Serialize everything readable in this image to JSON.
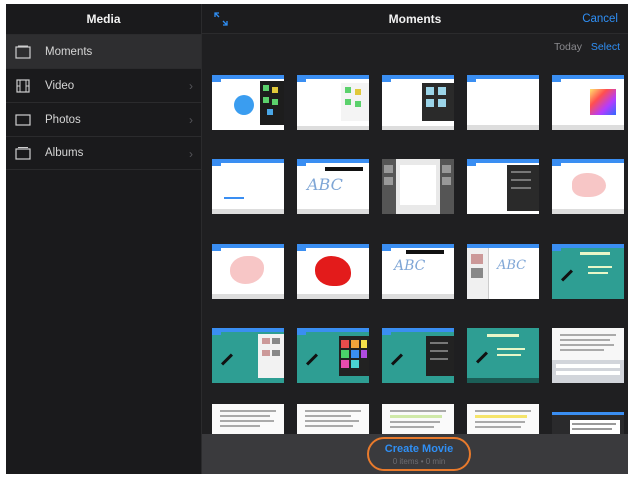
{
  "sidebar": {
    "title": "Media",
    "items": [
      {
        "label": "Moments",
        "icon": "moments-icon"
      },
      {
        "label": "Video",
        "icon": "film-icon"
      },
      {
        "label": "Photos",
        "icon": "photo-icon"
      },
      {
        "label": "Albums",
        "icon": "albums-icon"
      }
    ]
  },
  "header": {
    "title": "Moments",
    "cancel_label": "Cancel",
    "expand_icon": "expand-icon"
  },
  "subheader": {
    "date_label": "Today",
    "select_label": "Select"
  },
  "thumbnails": [
    {
      "kind": "whiteboard-with-blue-circle-and-tools"
    },
    {
      "kind": "whiteboard-green-tools"
    },
    {
      "kind": "whiteboard-grid-panel"
    },
    {
      "kind": "whiteboard-blank"
    },
    {
      "kind": "whiteboard-color-picker"
    },
    {
      "kind": "whiteboard-small-writing"
    },
    {
      "kind": "whiteboard-abc-text"
    },
    {
      "kind": "photo-grid-app"
    },
    {
      "kind": "dark-menu-panel"
    },
    {
      "kind": "whiteboard-pink-shape"
    },
    {
      "kind": "whiteboard-pink-blob"
    },
    {
      "kind": "whiteboard-red-blob"
    },
    {
      "kind": "whiteboard-abc-text-2"
    },
    {
      "kind": "split-panel-abc"
    },
    {
      "kind": "teal-title-slide"
    },
    {
      "kind": "teal-slide-with-panel"
    },
    {
      "kind": "teal-slide-color-grid"
    },
    {
      "kind": "teal-slide-dark-menu"
    },
    {
      "kind": "teal-title-slide-2"
    },
    {
      "kind": "document-with-keyboard"
    },
    {
      "kind": "document-page"
    },
    {
      "kind": "document-page-2"
    },
    {
      "kind": "document-page-highlight"
    },
    {
      "kind": "document-page-yellow"
    },
    {
      "kind": "document-app-dark"
    }
  ],
  "footer": {
    "button_label": "Create Movie",
    "button_sub": "0 items • 0 min"
  },
  "colors": {
    "accent": "#2f8ff5",
    "highlight_ring": "#e87a2c",
    "teal": "#2e9e93",
    "app_blue": "#3a8ef2"
  }
}
